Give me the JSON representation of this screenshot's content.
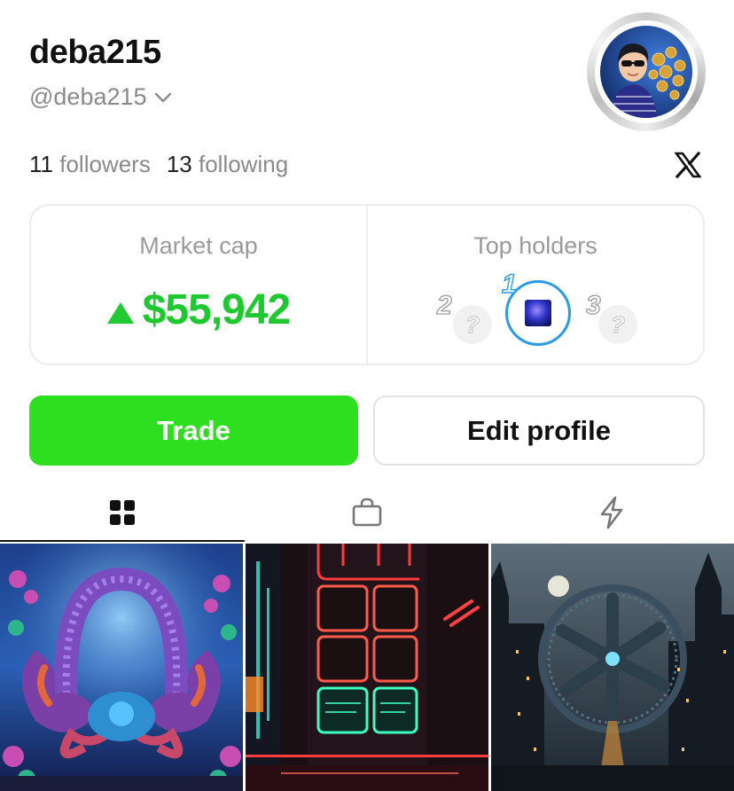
{
  "profile": {
    "display_name": "deba215",
    "handle": "@deba215",
    "followers_count": "11",
    "followers_label": "followers",
    "following_count": "13",
    "following_label": "following"
  },
  "stats": {
    "market_cap_label": "Market cap",
    "market_cap_value": "$55,942",
    "market_cap_trend": "up",
    "top_holders_label": "Top holders",
    "holders": [
      {
        "rank": "1",
        "placeholder": ""
      },
      {
        "rank": "2",
        "placeholder": "?"
      },
      {
        "rank": "3",
        "placeholder": "?"
      }
    ]
  },
  "actions": {
    "trade_label": "Trade",
    "edit_label": "Edit profile"
  },
  "tabs": [
    {
      "icon": "grid-icon",
      "active": true
    },
    {
      "icon": "shopping-bag-icon",
      "active": false
    },
    {
      "icon": "lightning-icon",
      "active": false
    }
  ],
  "colors": {
    "accent_green": "#2ddf1e",
    "market_green": "#1ec82f",
    "muted_text": "#8a8a8a"
  }
}
